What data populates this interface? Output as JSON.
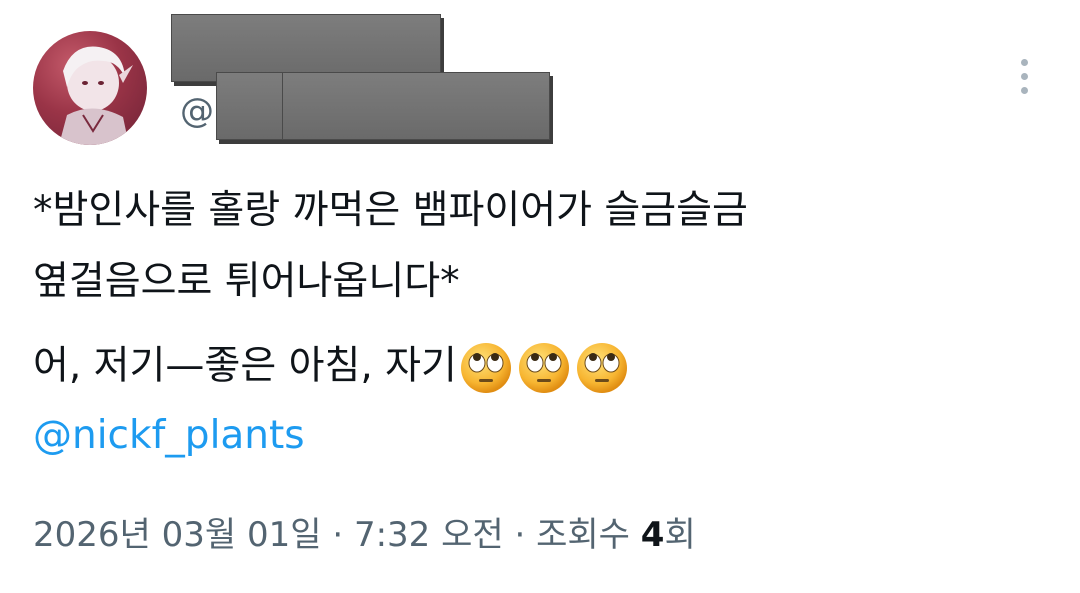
{
  "author": {
    "handle_prefix": "@"
  },
  "tweet": {
    "line1": "*밤인사를 홀랑 까먹은 뱀파이어가 슬금슬금",
    "line2": "옆걸음으로 튀어나옵니다*",
    "line3": "어, 저기—좋은 아침, 자기",
    "emojis": [
      "face-with-rolling-eyes",
      "face-with-rolling-eyes",
      "face-with-rolling-eyes"
    ],
    "mention": "@nickf_plants"
  },
  "meta": {
    "date": "2026년 03월 01일",
    "separator": "·",
    "time": "7:32 오전",
    "views_label": "조회수",
    "views_count": "4",
    "views_unit": "회"
  },
  "colors": {
    "text": "#0f1419",
    "secondary": "#536471",
    "link": "#1d9bf0",
    "redaction": "#6f6f6f"
  }
}
